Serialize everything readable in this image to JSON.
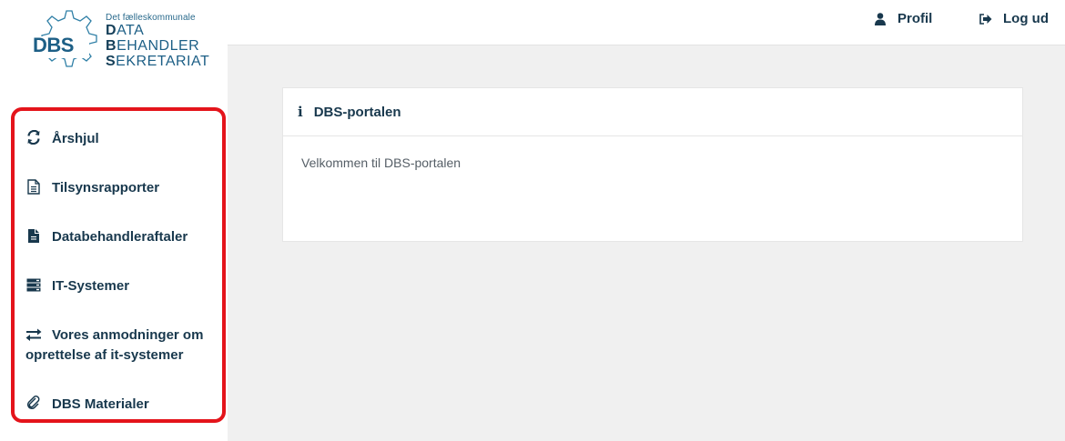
{
  "logo": {
    "badge": "DBS",
    "small": "Det fælleskommunale",
    "line1_first": "D",
    "line1_rest": "ATA",
    "line2_first": "B",
    "line2_rest": "EHANDLER",
    "line3_first": "S",
    "line3_rest": "EKRETARIAT"
  },
  "sidebar": {
    "items": [
      {
        "label": "Årshjul",
        "icon": "refresh-icon"
      },
      {
        "label": "Tilsynsrapporter",
        "icon": "document-outline-icon"
      },
      {
        "label": "Databehandleraftaler",
        "icon": "document-filled-icon"
      },
      {
        "label": "IT-Systemer",
        "icon": "server-icon"
      },
      {
        "label": "Vores anmodninger om oprettelse af it-systemer",
        "icon": "exchange-arrows-icon"
      },
      {
        "label": "DBS Materialer",
        "icon": "paperclip-icon"
      }
    ]
  },
  "header": {
    "profile_label": "Profil",
    "logout_label": "Log ud"
  },
  "panel": {
    "title": "DBS-portalen",
    "body": "Velkommen til DBS-portalen"
  },
  "colors": {
    "accent": "#18384d",
    "highlight": "#e4141b",
    "background": "#f0f0f0"
  }
}
